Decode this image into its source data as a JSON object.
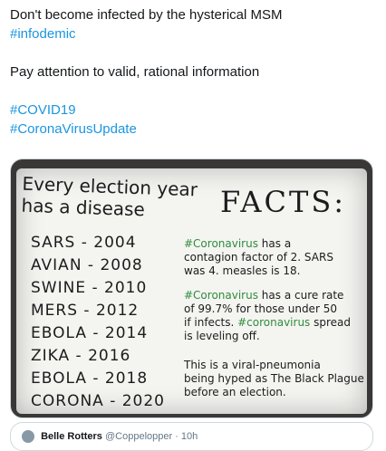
{
  "tweet": {
    "line1": "Don't become infected by the hysterical MSM",
    "tag1": "#infodemic",
    "line2": "Pay attention to valid, rational information",
    "tag2": "#COVID19",
    "tag3": "#CoronaVirusUpdate"
  },
  "image": {
    "left_title_1": "Every election year",
    "left_title_2": "has a disease",
    "list": [
      "SARS - 2004",
      "AVIAN - 2008",
      "SWINE - 2010",
      "MERS - 2012",
      "EBOLA - 2014",
      "ZIKA - 2016",
      "EBOLA - 2018",
      "CORONA - 2020"
    ],
    "facts": "FACTS:",
    "block1_green": "#Coronavirus",
    "block1_rest_a": " has a",
    "block1_line2": "contagion factor of 2. SARS",
    "block1_line3": "was 4. measles is 18.",
    "block2_green": "#Coronavirus",
    "block2_rest_a": " has a cure rate",
    "block2_line2": "of 99.7% for those under 50",
    "block2_line3a": "if infects. ",
    "block2_line3_green": "#coronavirus",
    "block2_line3b": " spread",
    "block2_line4": "is leveling off.",
    "block3_line1": "This is a viral-pneumonia",
    "block3_line2": "being hyped as The Black Plague",
    "block3_line3": "before an election."
  },
  "quote": {
    "name": "Belle Rotters",
    "handle": "@Coppelopper · 10h"
  }
}
